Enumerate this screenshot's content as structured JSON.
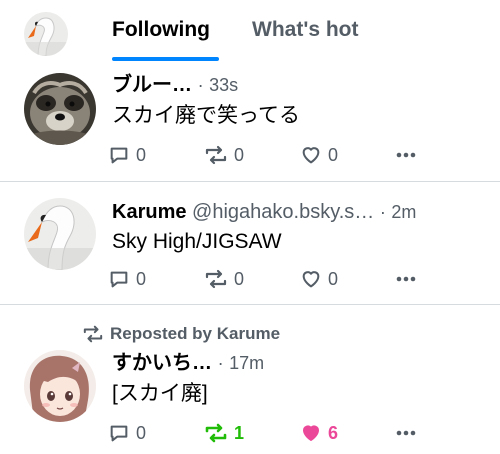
{
  "header": {
    "tabs": [
      {
        "label": "Following",
        "active": true
      },
      {
        "label": "What's hot",
        "active": false
      }
    ],
    "accent_color": "#0085ff"
  },
  "posts": [
    {
      "author": "ブルー…",
      "handle": "",
      "separator": "·",
      "time": "33s",
      "text": "スカイ廃で笑ってる",
      "replies": "0",
      "reposts": "0",
      "likes": "0",
      "avatar": "raccoon-dog-photo"
    },
    {
      "author": "Karume",
      "handle": "@higahako.bsky.s…",
      "separator": "·",
      "time": "2m",
      "text": "Sky High/JIGSAW",
      "replies": "0",
      "reposts": "0",
      "likes": "0",
      "avatar": "swan-photo"
    },
    {
      "reposted_by": "Reposted by Karume",
      "author": "すかいち…",
      "handle": "",
      "separator": "·",
      "time": "17m",
      "text": "[スカイ廃]",
      "replies": "0",
      "reposts": "1",
      "likes": "6",
      "reposted": true,
      "liked": true,
      "repost_color": "#20bc07",
      "like_color": "#ec4899",
      "avatar": "anime-girl-illustration"
    }
  ]
}
